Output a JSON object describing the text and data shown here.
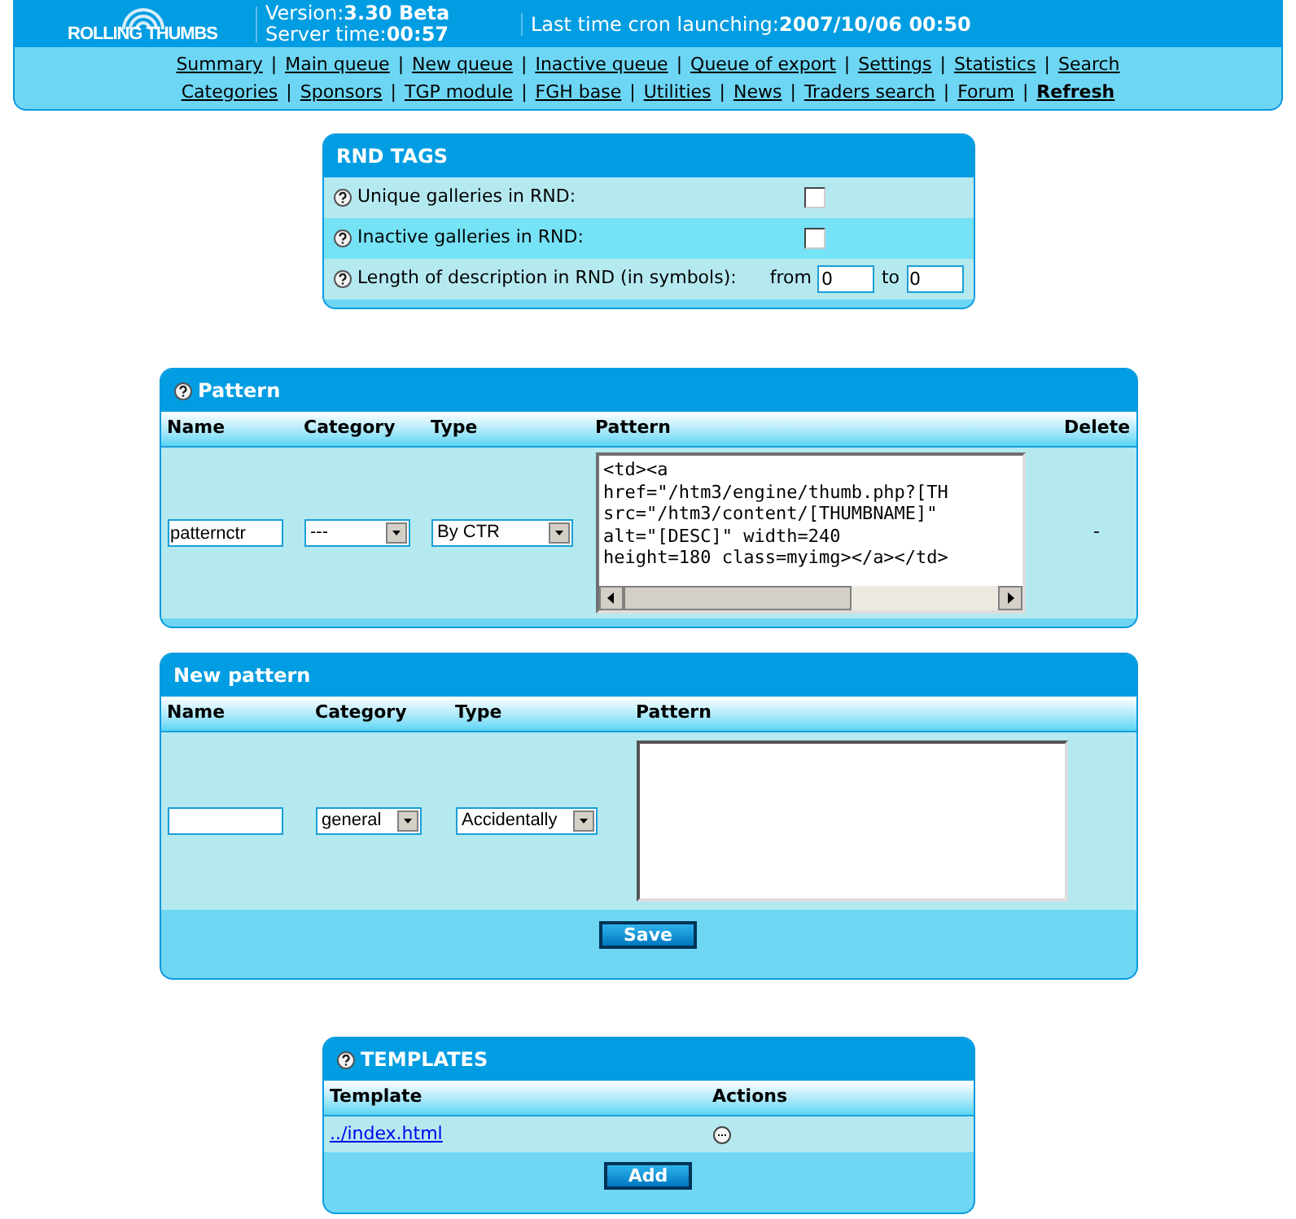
{
  "header": {
    "logo": "ROLLING THUMBS",
    "version_label": "Version:",
    "version": "3.30 Beta",
    "server_time_label": "Server time:",
    "server_time": "00:57",
    "cron_label": "Last time cron launching:",
    "cron": "2007/10/06 00:50"
  },
  "nav": {
    "separator": "|",
    "top_links": [
      {
        "label": "Summary",
        "bold": false
      },
      {
        "label": "Main queue",
        "bold": false
      },
      {
        "label": "New queue",
        "bold": false
      },
      {
        "label": "Inactive queue",
        "bold": false
      },
      {
        "label": "Queue of export",
        "bold": false
      },
      {
        "label": "Settings",
        "bold": false
      },
      {
        "label": "Statistics",
        "bold": false
      },
      {
        "label": "Search",
        "bold": false
      }
    ],
    "bottom_links": [
      {
        "label": "Categories",
        "bold": false
      },
      {
        "label": "Sponsors",
        "bold": false
      },
      {
        "label": "TGP module",
        "bold": false
      },
      {
        "label": "FGH base",
        "bold": false
      },
      {
        "label": "Utilities",
        "bold": false
      },
      {
        "label": "News",
        "bold": false
      },
      {
        "label": "Traders search",
        "bold": false
      },
      {
        "label": "Forum",
        "bold": false
      },
      {
        "label": "Refresh",
        "bold": true
      }
    ]
  },
  "rnd_tags": {
    "title": "RND TAGS",
    "rows": [
      {
        "kind": "checkbox",
        "label": "Unique galleries in RND:",
        "checked": false
      },
      {
        "kind": "checkbox",
        "label": "Inactive galleries in RND:",
        "checked": false
      },
      {
        "kind": "range",
        "label": "Length of description in RND (in symbols):",
        "from_label": "from",
        "from_value": "0",
        "to_label": "to",
        "to_value": "0"
      }
    ]
  },
  "pattern": {
    "title": "Pattern",
    "columns": [
      "Name",
      "Category",
      "Type",
      "Pattern",
      "Delete"
    ],
    "rows": [
      {
        "name": "patternctr",
        "category": "---",
        "type": "By CTR",
        "pattern_lines": [
          "<td><a",
          "href=\"/htm3/engine/thumb.php?[TH",
          "src=\"/htm3/content/[THUMBNAME]\"",
          "alt=\"[DESC]\" width=240",
          "height=180 class=myimg></a></td>"
        ],
        "delete": "-"
      }
    ]
  },
  "new_pattern": {
    "title": "New pattern",
    "columns": [
      "Name",
      "Category",
      "Type",
      "Pattern"
    ],
    "category": "general",
    "type": "Accidentally",
    "save": "Save"
  },
  "templates": {
    "title": "TEMPLATES",
    "columns": [
      "Template",
      "Actions"
    ],
    "rows": [
      {
        "template": "../index.html"
      }
    ],
    "add": "Add"
  }
}
